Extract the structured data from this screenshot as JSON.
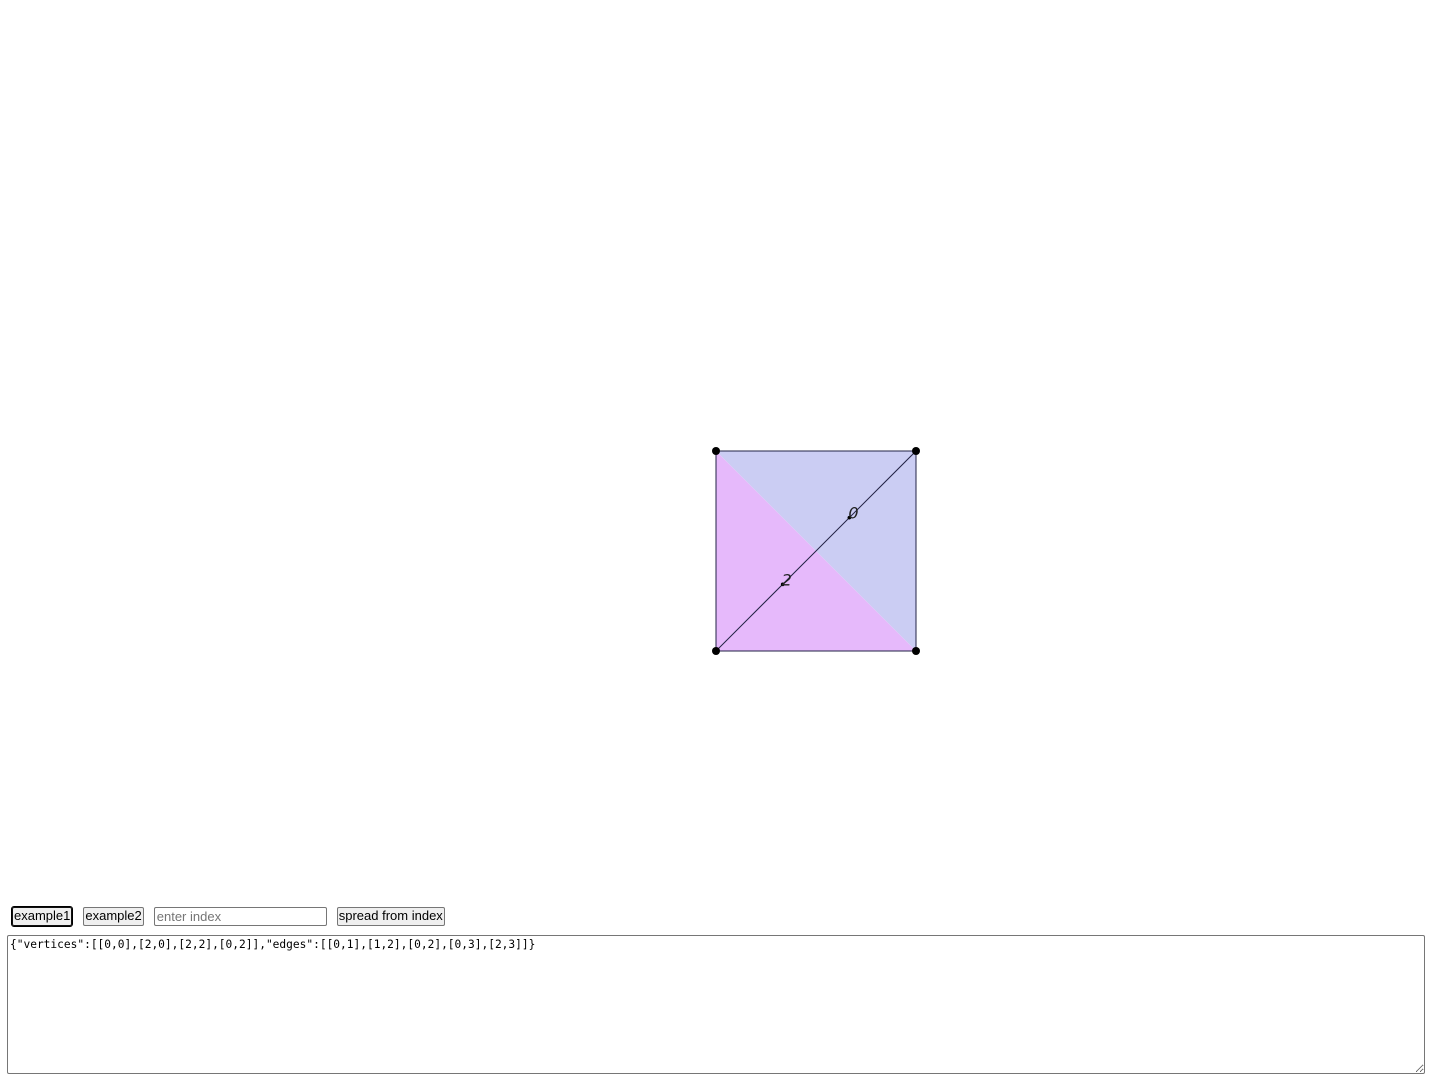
{
  "graph": {
    "vertices": [
      [
        0,
        0
      ],
      [
        2,
        0
      ],
      [
        2,
        2
      ],
      [
        0,
        2
      ]
    ],
    "faces": [
      {
        "label": "0",
        "fill": "#cbcdf3",
        "vertices": [
          3,
          2,
          1
        ]
      },
      {
        "label": "2",
        "fill": "#e6b9fb",
        "vertices": [
          3,
          0,
          1
        ]
      }
    ],
    "edge_color": "#222244",
    "vertex_color": "#000000"
  },
  "controls": {
    "example1_label": "example1",
    "example2_label": "example2",
    "index_placeholder": "enter index",
    "index_value": "",
    "spread_label": "spread from index"
  },
  "editor": {
    "json_text": "{\"vertices\":[[0,0],[2,0],[2,2],[0,2]],\"edges\":[[0,1],[1,2],[0,2],[0,3],[2,3]]}"
  }
}
